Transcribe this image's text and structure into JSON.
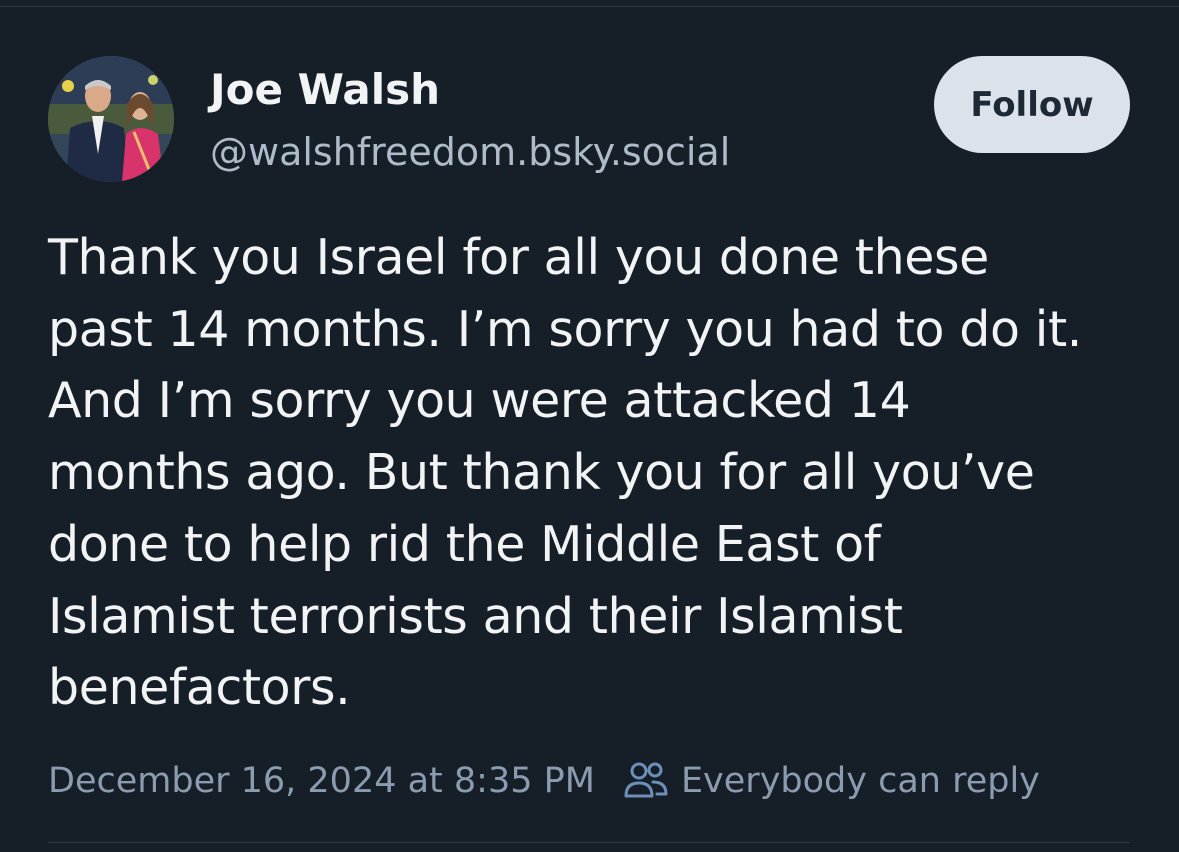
{
  "author": {
    "display_name": "Joe Walsh",
    "handle": "@walshfreedom.bsky.social",
    "avatar_icon": "profile-photo"
  },
  "follow_button": {
    "label": "Follow"
  },
  "post": {
    "lines": [
      "Thank you Israel for all you done these",
      "past 14 months. I’m sorry you had to do it.",
      "And I’m sorry you were attacked 14",
      "months ago. But thank you for all you’ve",
      "done to help rid the Middle East of",
      "Islamist terrorists and their Islamist",
      "benefactors."
    ],
    "timestamp": "December 16, 2024 at 8:35 PM",
    "reply_setting": "Everybody can reply",
    "reply_icon": "people-icon"
  },
  "colors": {
    "background": "#161e27",
    "text_primary": "#f1f3f5",
    "text_secondary": "#aebbc9",
    "meta_text": "#8b9cb0",
    "follow_bg": "#dce2ea",
    "follow_text": "#1e2936"
  }
}
